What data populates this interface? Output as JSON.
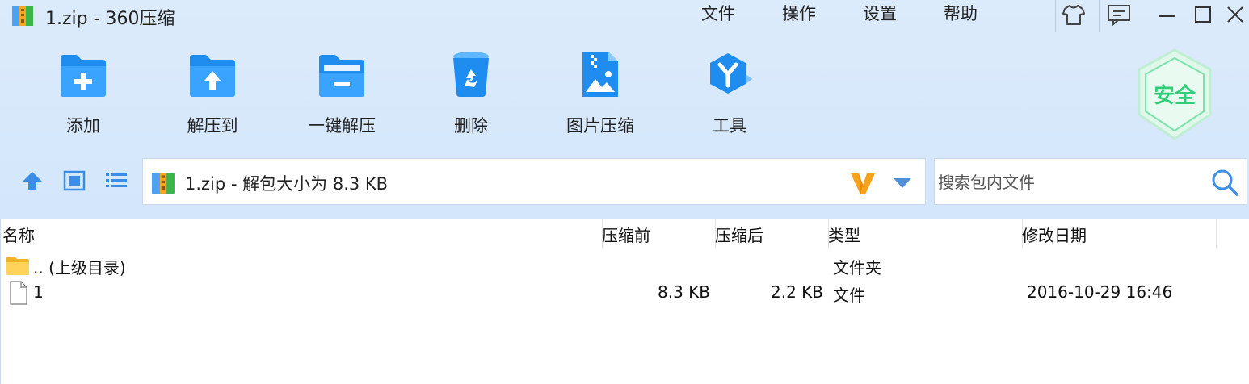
{
  "window": {
    "title": "1.zip - 360压缩",
    "menu": [
      "文件",
      "操作",
      "设置",
      "帮助"
    ],
    "icons": [
      "skin-icon",
      "feedback-icon",
      "minimize-icon",
      "maximize-icon",
      "close-icon"
    ]
  },
  "toolbar": {
    "add": "添加",
    "extract_to": "解压到",
    "one_click_extract": "一键解压",
    "delete": "删除",
    "image_compress": "图片压缩",
    "tools": "工具"
  },
  "security_badge": "安全",
  "address": {
    "text": "1.zip - 解包大小为 8.3 KB"
  },
  "search": {
    "placeholder": "搜索包内文件"
  },
  "columns": {
    "name": "名称",
    "before": "压缩前",
    "after": "压缩后",
    "type": "类型",
    "modified": "修改日期"
  },
  "rows": [
    {
      "name": ".. (上级目录)",
      "before": "",
      "after": "",
      "type": "文件夹",
      "modified": "",
      "icon": "folder-icon"
    },
    {
      "name": "1",
      "before": "8.3 KB",
      "after": "2.2 KB",
      "type": "文件",
      "modified": "2016-10-29 16:46",
      "icon": "file-icon"
    }
  ],
  "colors": {
    "chrome_bg": "#d3e6fb",
    "accent_blue": "#2a8df0",
    "badge_green": "#3fcf86",
    "v_logo_orange": "#f7a21b"
  }
}
